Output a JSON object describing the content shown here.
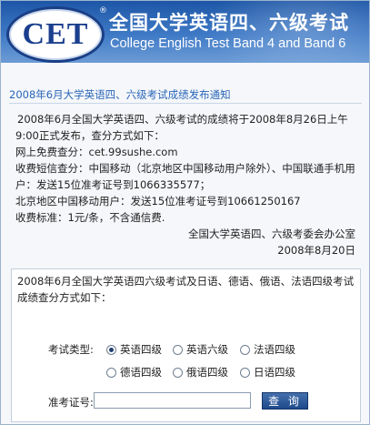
{
  "header": {
    "logo_text": "CET",
    "registered_mark": "®",
    "title_cn": "全国大学英语四、六级考试",
    "title_en": "College English Test Band 4 and Band 6"
  },
  "notice": {
    "title": "2008年6月大学英语四、六级考试成绩发布通知",
    "lines": [
      "2008年6月全国大学英语四、六级考试的成绩将于2008年8月26日上午9:00正式发布，查分方式如下：",
      "网上免费查分：cet.99sushe.com",
      "收费短信查分：中国移动（北京地区中国移动用户除外）、中国联通手机用户：发送15位准考证号到1066335577；",
      "北京地区中国移动用户：发送15位准考证号到10661250167",
      "收费标准：1元/条，不含通信费."
    ],
    "signature": "全国大学英语四、六级考委会办公室",
    "date": "2008年8月20日"
  },
  "query": {
    "intro": "2008年6月全国大学英语四六级考试及日语、德语、俄语、法语四级考试成绩查分方式如下：",
    "exam_type_label": "考试类型:",
    "options": [
      "英语四级",
      "英语六级",
      "法语四级",
      "德语四级",
      "俄语四级",
      "日语四级"
    ],
    "selected": "英语四级",
    "id_label": "准考证号:",
    "id_value": "",
    "button_label": "查 询"
  },
  "colors": {
    "banner": "#1d56a6",
    "link_title": "#2a66b8",
    "button": "#1e4a8a"
  }
}
